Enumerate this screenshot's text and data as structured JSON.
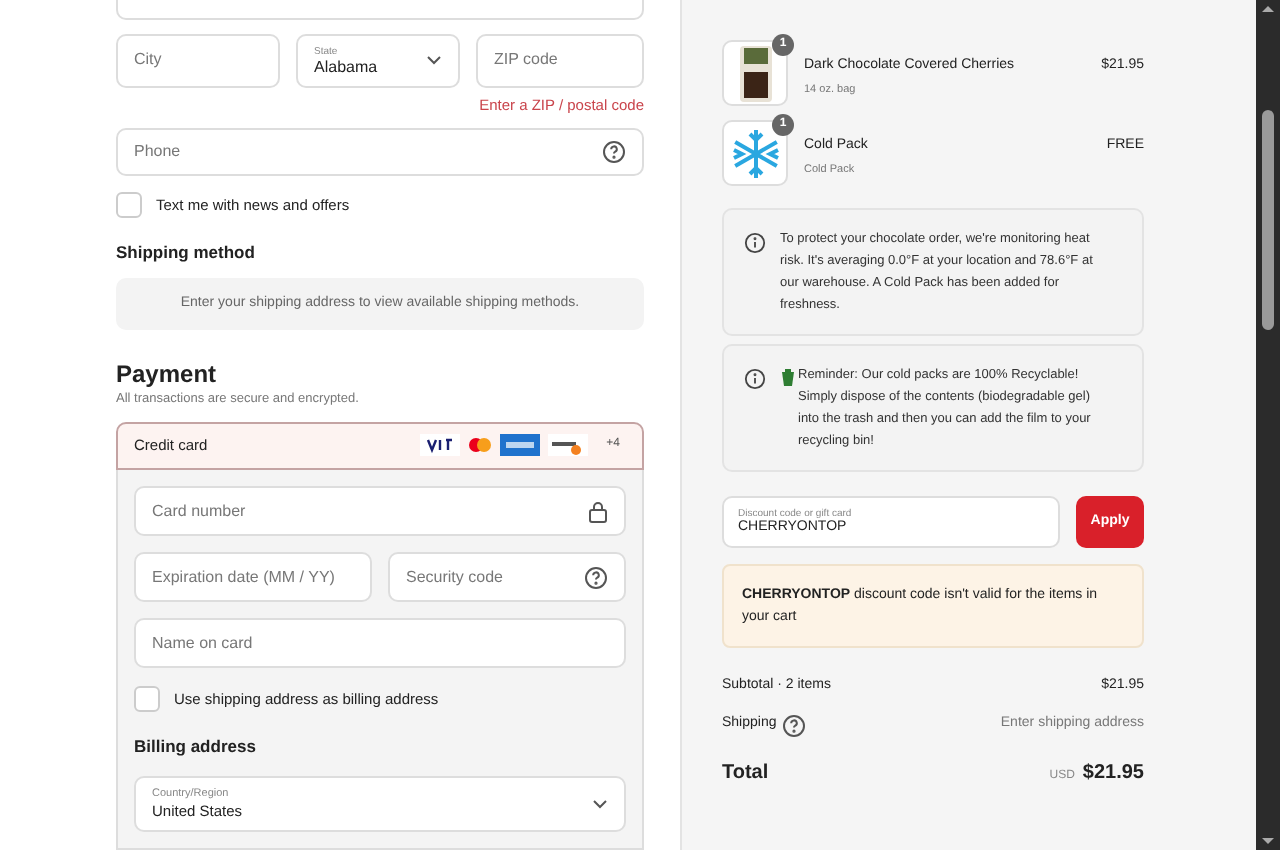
{
  "address": {
    "city": {
      "placeholder": "City"
    },
    "state": {
      "label": "State",
      "value": "Alabama"
    },
    "zip": {
      "placeholder": "ZIP code",
      "invalid": true,
      "error": "Enter a ZIP / postal code"
    },
    "phone": {
      "placeholder": "Phone"
    },
    "sms_opt_in": {
      "label": "Text me with news and offers",
      "checked": false
    }
  },
  "shipping_method": {
    "heading": "Shipping method",
    "notice": "Enter your shipping address to view available shipping methods."
  },
  "payment": {
    "heading": "Payment",
    "subtitle": "All transactions are secure and encrypted.",
    "method": {
      "label": "Credit card",
      "selected": true,
      "more_cards": "+4"
    },
    "fields": [
      {
        "placeholder": "Card number",
        "kind": "secure"
      },
      {
        "placeholder": "Expiration date (MM / YY)",
        "kind": "plain"
      },
      {
        "placeholder": "Security code",
        "kind": "hint"
      },
      {
        "placeholder": "Name on card",
        "kind": "plain"
      }
    ],
    "same_billing": {
      "label": "Use shipping address as billing address",
      "checked": false
    },
    "billing": {
      "heading": "Billing address",
      "country": {
        "label": "Country/Region",
        "value": "United States"
      }
    }
  },
  "cart": {
    "items": [
      {
        "kind": "product",
        "name": "Dark Chocolate Covered Cherries",
        "variant": "14 oz. bag",
        "price": "$21.95",
        "quantity": "1"
      },
      {
        "kind": "coldpack",
        "name": "Cold Pack",
        "variant": "Cold Pack",
        "price": "FREE",
        "quantity": "1"
      }
    ],
    "notices": [
      {
        "text": "To protect your chocolate order, we're monitoring heat risk. It's averaging 0.0°F at your location and 78.6°F at our warehouse. A Cold Pack has been added for freshness.",
        "emoji": false
      },
      {
        "text": "Reminder: Our cold packs are 100% Recyclable! Simply dispose of the contents (biodegradable gel) into the trash and then you can add the film to your recycling bin!",
        "emoji": true
      }
    ],
    "discount": {
      "label": "Discount code or gift card",
      "value": "CHERRYONTOP",
      "button": "Apply"
    },
    "discount_error": "**CHERRYONTOP** discount code isn't valid for the items in your cart",
    "subtotal": {
      "label": "Subtotal · 2 items",
      "value": "$21.95"
    },
    "shipping": {
      "label": "Shipping",
      "value": "Enter shipping address"
    },
    "total": {
      "label": "Total",
      "currency": "USD",
      "value": "$21.95"
    }
  }
}
